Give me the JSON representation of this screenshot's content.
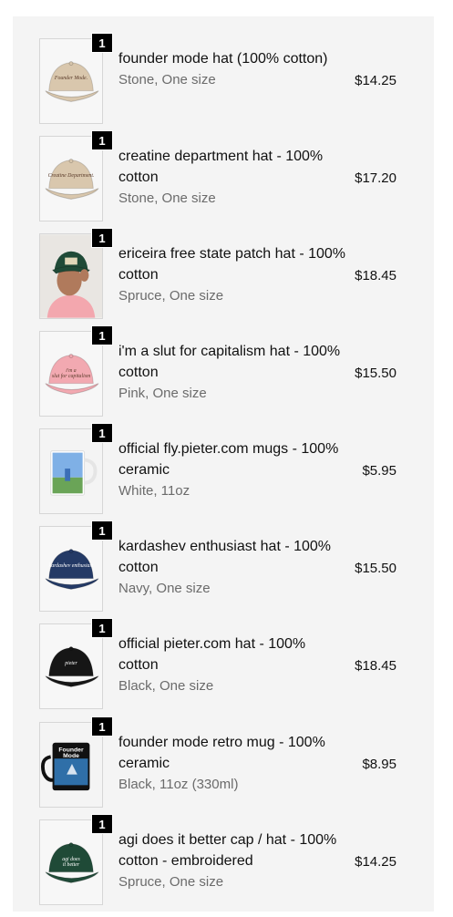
{
  "items": [
    {
      "qty": "1",
      "title": "founder mode hat (100% cotton)",
      "variant": "Stone, One size",
      "price": "$14.25",
      "image": "cap",
      "color": "#d9c7ad",
      "print": "Founder Mode."
    },
    {
      "qty": "1",
      "title": "creatine department hat - 100% cotton",
      "variant": "Stone, One size",
      "price": "$17.20",
      "image": "cap",
      "color": "#d9c7ad",
      "print": "Creatine Department."
    },
    {
      "qty": "1",
      "title": "ericeira free state patch hat - 100% cotton",
      "variant": "Spruce, One size",
      "price": "$18.45",
      "image": "model-cap",
      "color": "#1f4a37",
      "print": ""
    },
    {
      "qty": "1",
      "title": "i'm a slut for capitalism hat - 100% cotton",
      "variant": "Pink, One size",
      "price": "$15.50",
      "image": "cap",
      "color": "#f2a9b1",
      "print": "i'm a slut for capitalism"
    },
    {
      "qty": "1",
      "title": "official fly.pieter.com mugs - 100% ceramic",
      "variant": "White, 11oz",
      "price": "$5.95",
      "image": "mug-white",
      "color": "#ffffff",
      "print": ""
    },
    {
      "qty": "1",
      "title": "kardashev enthusiast hat - 100% cotton",
      "variant": "Navy, One size",
      "price": "$15.50",
      "image": "cap",
      "color": "#243a66",
      "print": "kardashev enthusiast"
    },
    {
      "qty": "1",
      "title": "official pieter.com hat - 100% cotton",
      "variant": "Black, One size",
      "price": "$18.45",
      "image": "cap",
      "color": "#161616",
      "print": "pieter"
    },
    {
      "qty": "1",
      "title": "founder mode retro mug - 100% ceramic",
      "variant": "Black, 11oz (330ml)",
      "price": "$8.95",
      "image": "mug-black",
      "color": "#111111",
      "print": "Founder Mode"
    },
    {
      "qty": "1",
      "title": "agi does it better cap / hat - 100% cotton - embroidered",
      "variant": "Spruce, One size",
      "price": "$14.25",
      "image": "cap",
      "color": "#1f4a37",
      "print": "agi does it better"
    }
  ]
}
